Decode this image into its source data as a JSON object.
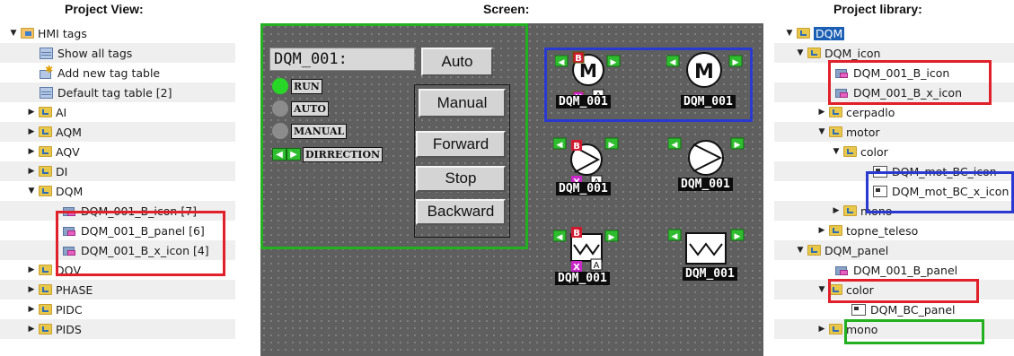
{
  "panels": {
    "project_view_title": "Project View:",
    "screen_title": "Screen:",
    "library_title": "Project library:"
  },
  "project_tree": [
    {
      "label": "HMI tags",
      "arrow": "▼",
      "icon": "hmi-folder-icon"
    },
    {
      "label": "Show all tags",
      "arrow": "",
      "icon": "table-icon"
    },
    {
      "label": "Add new tag table",
      "arrow": "",
      "icon": "add-star-icon"
    },
    {
      "label": "Default tag table [2]",
      "arrow": "",
      "icon": "table-icon"
    },
    {
      "label": "AI",
      "arrow": "▶",
      "icon": "folder-icon"
    },
    {
      "label": "AQM",
      "arrow": "▶",
      "icon": "folder-icon"
    },
    {
      "label": "AQV",
      "arrow": "▶",
      "icon": "folder-icon"
    },
    {
      "label": "DI",
      "arrow": "▶",
      "icon": "folder-icon"
    },
    {
      "label": "DQM",
      "arrow": "▼",
      "icon": "folder-icon"
    },
    {
      "label": "DQM_001_B_icon [7]",
      "arrow": "",
      "icon": "tag-icon"
    },
    {
      "label": "DQM_001_B_panel [6]",
      "arrow": "",
      "icon": "tag-icon"
    },
    {
      "label": "DQM_001_B_x_icon [4]",
      "arrow": "",
      "icon": "tag-icon"
    },
    {
      "label": "DQV",
      "arrow": "▶",
      "icon": "folder-icon"
    },
    {
      "label": "PHASE",
      "arrow": "▶",
      "icon": "folder-icon"
    },
    {
      "label": "PIDC",
      "arrow": "▶",
      "icon": "folder-icon"
    },
    {
      "label": "PIDS",
      "arrow": "▶",
      "icon": "folder-icon"
    }
  ],
  "faceplate": {
    "header": "DQM_001:",
    "status": [
      "RUN",
      "AUTO",
      "MANUAL"
    ],
    "direction_label": "DIRRECTION",
    "buttons": {
      "auto": "Auto",
      "manual": "Manual",
      "forward": "Forward",
      "stop": "Stop",
      "backward": "Backward"
    }
  },
  "symbols": {
    "name": "DQM_001",
    "b_badge": "B",
    "x_badge": "X",
    "a_badge": "A",
    "motor_letter": "M"
  },
  "library_tree": [
    {
      "label": "DQM",
      "arrow": "▼",
      "icon": "lib-folder-icon",
      "selected": true
    },
    {
      "label": "DQM_icon",
      "arrow": "▼",
      "icon": "lib-folder-icon"
    },
    {
      "label": "DQM_001_B_icon",
      "arrow": "",
      "icon": "tag-icon"
    },
    {
      "label": "DQM_001_B_x_icon",
      "arrow": "",
      "icon": "tag-icon"
    },
    {
      "label": "cerpadlo",
      "arrow": "▶",
      "icon": "lib-folder-icon"
    },
    {
      "label": "motor",
      "arrow": "▼",
      "icon": "lib-folder-icon"
    },
    {
      "label": "color",
      "arrow": "▼",
      "icon": "lib-folder-icon"
    },
    {
      "label": "DQM_mot_BC_icon",
      "arrow": "",
      "icon": "faceplate-icon"
    },
    {
      "label": "DQM_mot_BC_x_icon",
      "arrow": "",
      "icon": "faceplate-icon"
    },
    {
      "label": "mono",
      "arrow": "▶",
      "icon": "lib-folder-icon"
    },
    {
      "label": "topne_teleso",
      "arrow": "▶",
      "icon": "lib-folder-icon"
    },
    {
      "label": "DQM_panel",
      "arrow": "▼",
      "icon": "lib-folder-icon"
    },
    {
      "label": "DQM_001_B_panel",
      "arrow": "",
      "icon": "tag-icon"
    },
    {
      "label": "color",
      "arrow": "▼",
      "icon": "lib-folder-icon"
    },
    {
      "label": "DQM_BC_panel",
      "arrow": "",
      "icon": "faceplate-icon"
    },
    {
      "label": "mono",
      "arrow": "▶",
      "icon": "lib-folder-icon"
    }
  ],
  "colors": {
    "highlight_red": "#e0202a",
    "highlight_blue": "#2a3ad0",
    "highlight_green": "#22b020",
    "selection": "#1a5fb4",
    "led_on": "#27d627",
    "led_off": "#8c8c8c"
  }
}
